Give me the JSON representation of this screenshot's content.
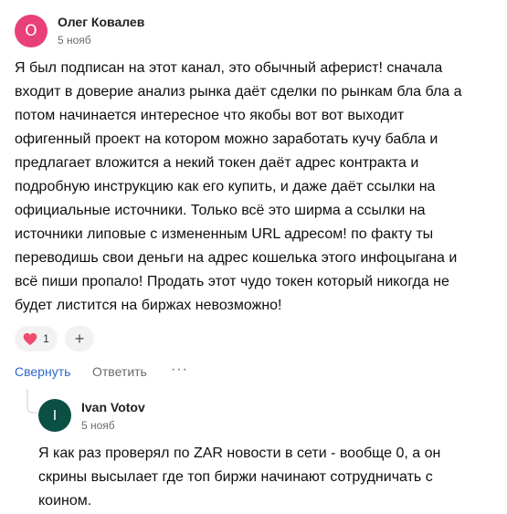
{
  "colors": {
    "avatar1_bg": "#e8407a",
    "avatar2_bg": "#0b4f45",
    "link": "#2e67c8",
    "muted": "#6b6b6b",
    "heart": "#ee4d6e"
  },
  "comment": {
    "avatar_letter": "О",
    "author": "Олег Ковалев",
    "date": "5 нояб",
    "lines": [
      "Я был подписан на этот канал, это обычный аферист! сначала",
      "входит в доверие анализ рынка даёт сделки по рынкам бла бла а",
      "потом начинается интересное что якобы вот вот выходит",
      "офигенный проект на котором можно заработать кучу бабла и",
      "предлагает вложится а некий токен даёт адрес контракта и",
      "подробную инструкцию как его купить, и даже даёт ссылки на",
      "официальные источники. Только всё это ширма а ссылки на",
      "источники липовые с измененным URL адресом! по факту ты",
      "переводишь свои деньги на адрес кошелька этого инфоцыгана и",
      "всё пиши пропало! Продать этот чудо токен который никогда не",
      "будет листится на биржах невозможно!"
    ],
    "reaction": {
      "icon": "heart-icon",
      "count": "1"
    },
    "add_reaction": {
      "icon": "plus-icon",
      "glyph": "+"
    },
    "actions": {
      "collapse": "Свернуть",
      "reply": "Ответить",
      "more": "···"
    }
  },
  "reply": {
    "avatar_letter": "I",
    "author": "Ivan Votov",
    "date": "5 нояб",
    "lines": [
      "Я как раз проверял по ZAR новости в сети - вообще 0, а он",
      "скрины высылает где топ биржи начинают сотрудничать с",
      "коином."
    ]
  }
}
